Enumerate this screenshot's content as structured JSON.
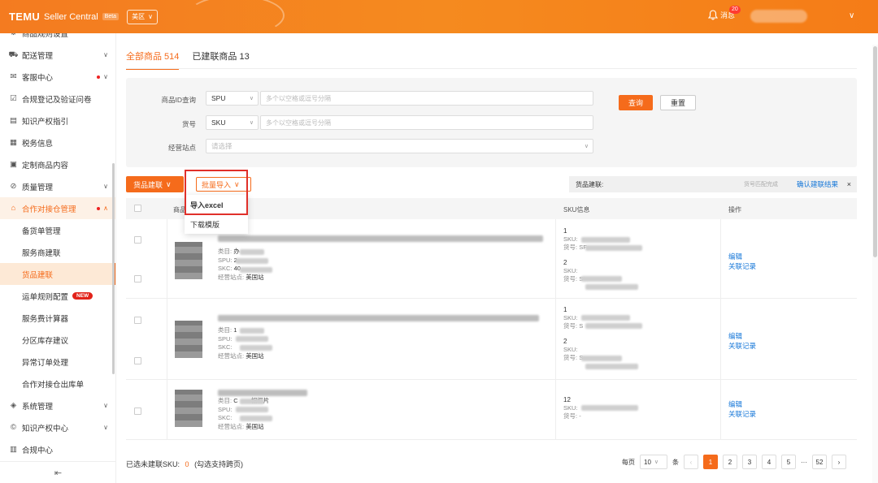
{
  "header": {
    "brand": "TEMU",
    "brand_sub": "Seller Central",
    "beta": "Beta",
    "region": "美区",
    "notice_label": "消息",
    "notice_count": "20"
  },
  "sidebar": {
    "items": [
      {
        "label": "商品规则设置",
        "icon": "gear-icon"
      },
      {
        "label": "配送管理",
        "icon": "truck-icon",
        "arrow": "∨"
      },
      {
        "label": "客服中心",
        "icon": "chat-icon",
        "arrow": "∨",
        "dot": true
      },
      {
        "label": "合规登记及验证问卷",
        "icon": "clipboard-icon"
      },
      {
        "label": "知识产权指引",
        "icon": "book-icon"
      },
      {
        "label": "税务信息",
        "icon": "document-icon"
      },
      {
        "label": "定制商品内容",
        "icon": "image-icon"
      },
      {
        "label": "质量管理",
        "icon": "shield-check-icon",
        "arrow": "∨"
      },
      {
        "label": "合作对接仓管理",
        "icon": "warehouse-icon",
        "arrow": "∧",
        "dot": true
      }
    ],
    "sub_items": [
      {
        "label": "备货单管理"
      },
      {
        "label": "服务商建联"
      },
      {
        "label": "货品建联",
        "active": true
      },
      {
        "label": "运单规则配置",
        "badge": "NEW"
      },
      {
        "label": "服务费计算器"
      },
      {
        "label": "分区库存建议"
      },
      {
        "label": "异常订单处理"
      },
      {
        "label": "合作对接仓出库单"
      }
    ],
    "bottom_items": [
      {
        "label": "系统管理",
        "icon": "shield-icon",
        "arrow": "∨"
      },
      {
        "label": "知识产权中心",
        "icon": "copyright-icon",
        "arrow": "∨"
      },
      {
        "label": "合规中心",
        "icon": "file-icon"
      }
    ],
    "collapse": "⇤"
  },
  "tabs": {
    "all": "全部商品 514",
    "linked": "已建联商品 13"
  },
  "filters": {
    "id_label": "商品ID查询",
    "id_type": "SPU",
    "id_placeholder": "多个以空格或逗号分隔",
    "code_label": "货号",
    "code_type": "SKU",
    "code_placeholder": "多个以空格或逗号分隔",
    "site_label": "经营站点",
    "site_placeholder": "请选择",
    "query": "查询",
    "reset": "重置"
  },
  "toolbar": {
    "link_goods": "货品建联",
    "batch_import": "批量导入",
    "status_label": "货品建联:",
    "match_text": "货号匹配完成",
    "confirm": "确认建联结果",
    "close": "×"
  },
  "dropdown": {
    "import_excel": "导入excel",
    "download_template": "下载模版"
  },
  "table": {
    "headers": {
      "product": "商品",
      "sku": "SKU信息",
      "ops": "操作"
    },
    "meta_labels": {
      "category": "类目:",
      "spu": "SPU:",
      "skc": "SKC:",
      "site": "经营站点:"
    },
    "rows": [
      {
        "category": "办",
        "spu": "2",
        "skc": "40",
        "site": "美国站",
        "skus": [
          {
            "num": "1",
            "sku_label": "SKU:",
            "code_label": "货号:",
            "code": "SF"
          },
          {
            "num": "2",
            "sku_label": "SKU:",
            "code_label": "货号:",
            "code": "S"
          }
        ],
        "edit": "编辑",
        "records": "关联记录"
      },
      {
        "category": "1",
        "spu": "",
        "skc": "",
        "site": "美国站",
        "skus": [
          {
            "num": "1",
            "sku_label": "SKU:",
            "code_label": "货号:",
            "code": "S"
          },
          {
            "num": "2",
            "sku_label": "SKU:",
            "code_label": "货号:",
            "code": "S"
          }
        ],
        "edit": "编辑",
        "records": "关联记录"
      },
      {
        "category": "C",
        "category_tail": "相框片",
        "spu": "",
        "skc": "",
        "site": "美国站",
        "skus": [
          {
            "num": "12",
            "sku_label": "SKU:",
            "code_label": "货号:",
            "code": "-"
          }
        ],
        "edit": "编辑",
        "records": "关联记录"
      }
    ]
  },
  "footer": {
    "selected_label": "已选未建联SKU:",
    "selected_count": "0",
    "selected_hint": "(勾选支持跨页)",
    "per_page_label": "每页",
    "per_page_value": "10",
    "per_page_unit": "条",
    "pages": [
      "1",
      "2",
      "3",
      "4",
      "5"
    ],
    "ellipsis": "···",
    "last_page": "52",
    "prev": "‹",
    "next": "›"
  },
  "colors": {
    "accent": "#f56b1b",
    "link": "#1677d8",
    "highlight": "#e0302a"
  }
}
